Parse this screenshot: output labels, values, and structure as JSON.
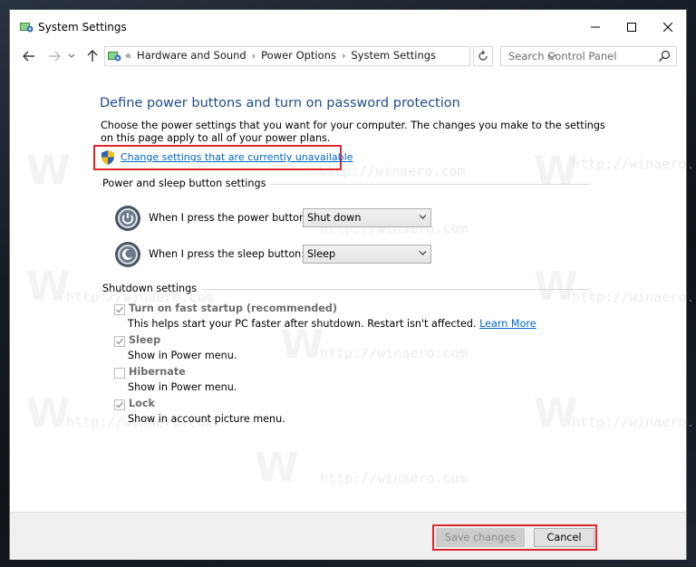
{
  "window": {
    "title": "System Settings"
  },
  "nav": {
    "breadcrumb_prefix": "«",
    "crumbs": [
      "Hardware and Sound",
      "Power Options",
      "System Settings"
    ],
    "crumb_separator": "›",
    "search_placeholder": "Search Control Panel"
  },
  "content": {
    "title": "Define power buttons and turn on password protection",
    "description": "Choose the power settings that you want for your computer. The changes you make to the settings on this page apply to all of your power plans.",
    "change_link": "Change settings that are currently unavailable",
    "power_sleep_section": "Power and sleep button settings",
    "power_button_label": "When I press the power button:",
    "power_button_value": "Shut down",
    "sleep_button_label": "When I press the sleep button:",
    "sleep_button_value": "Sleep",
    "shutdown_section": "Shutdown settings",
    "options": [
      {
        "label": "Turn on fast startup (recommended)",
        "bold": true,
        "checked": true,
        "desc": "This helps start your PC faster after shutdown. Restart isn't affected.",
        "link": "Learn More"
      },
      {
        "label": "Sleep",
        "bold": true,
        "checked": true,
        "desc": "Show in Power menu."
      },
      {
        "label": "Hibernate",
        "bold": true,
        "checked": false,
        "desc": "Show in Power menu."
      },
      {
        "label": "Lock",
        "bold": true,
        "checked": true,
        "desc": "Show in account picture menu."
      }
    ]
  },
  "footer": {
    "save_label": "Save changes",
    "cancel_label": "Cancel"
  },
  "watermark": {
    "text": "http://winaero.com",
    "letter": "W"
  },
  "colors": {
    "title_blue": "#1e4e8c",
    "link_blue": "#0066cc",
    "highlight_red": "#e0262b"
  }
}
